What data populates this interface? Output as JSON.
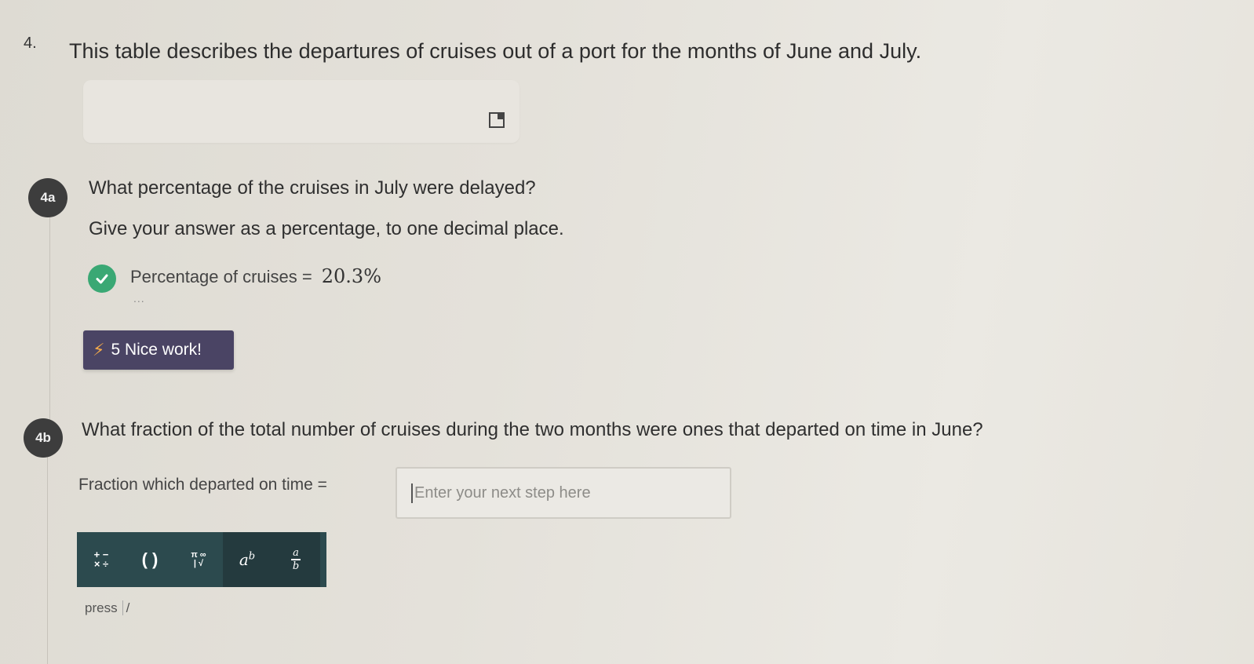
{
  "question": {
    "number": "4.",
    "title": "This table describes the departures of cruises out of a port for the months of June and July."
  },
  "part_a": {
    "badge": "4a",
    "prompt": "What percentage of the cruises in July were delayed?",
    "instruction": "Give your answer as a percentage, to one decimal place.",
    "answer_label": "Percentage of cruises =",
    "answer_value": "20.3%",
    "ellipsis": "...",
    "feedback": "5 Nice work!"
  },
  "part_b": {
    "badge": "4b",
    "prompt": "What fraction of the total number of cruises during the two months were ones that departed on time in June?",
    "answer_label": "Fraction which departed on time =",
    "input_placeholder": "Enter your next step here",
    "input_value": ""
  },
  "toolbar": {
    "buttons": [
      {
        "name": "operators",
        "label_top": "+ −",
        "label_bottom": "× ÷"
      },
      {
        "name": "parentheses",
        "label": "( )"
      },
      {
        "name": "symbols",
        "label_top": "π ∞",
        "label_bottom": "| √"
      },
      {
        "name": "power",
        "base": "a",
        "exp": "b"
      },
      {
        "name": "fraction",
        "num": "a",
        "den": "b"
      }
    ]
  },
  "hint": {
    "press": "press",
    "key": "/"
  },
  "colors": {
    "badge": "#3d3d3d",
    "check": "#3aa874",
    "feedback_bg": "#4a4464",
    "toolbar_bg": "#2c4a4e"
  }
}
